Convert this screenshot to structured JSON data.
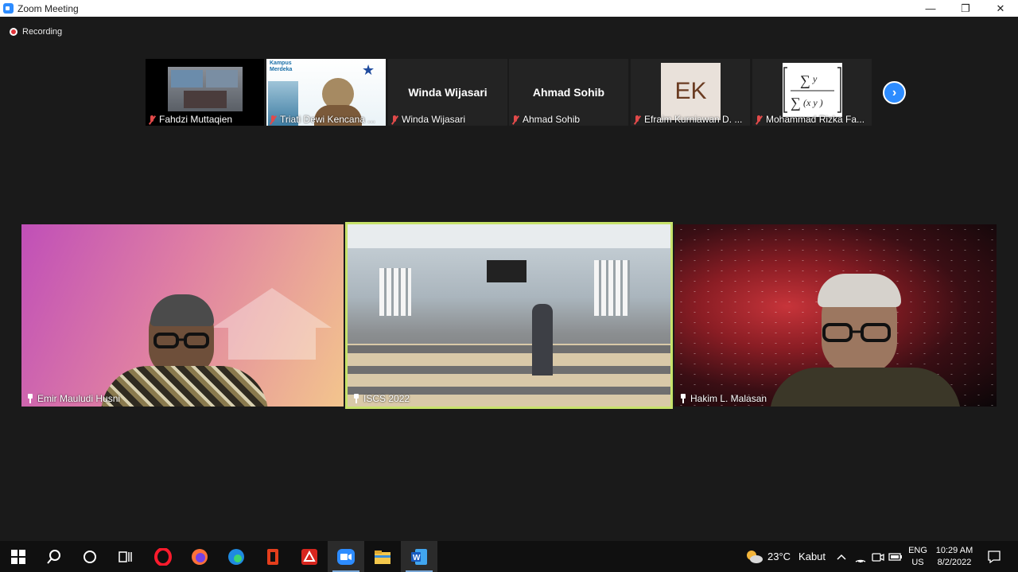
{
  "window": {
    "title": "Zoom Meeting",
    "minimize": "—",
    "maximize": "❐",
    "close": "✕"
  },
  "recording": {
    "label": "Recording"
  },
  "thumbnails": [
    {
      "name": "Fahdzi Muttaqien",
      "display": ""
    },
    {
      "name": "Triati Dewi Kencana ...",
      "display": ""
    },
    {
      "name": "Winda Wijasari",
      "display": "Winda Wijasari"
    },
    {
      "name": "Ahmad Sohib",
      "display": "Ahmad Sohib"
    },
    {
      "name": "Efraim Kurniawan D. ...",
      "display": "EK"
    },
    {
      "name": "Mohammad Rizka Fa...",
      "display": ""
    }
  ],
  "thumb_logo": {
    "line1": "Kampus",
    "line2": "Merdeka"
  },
  "next_button": "›",
  "tiles": [
    {
      "name": "Emir Mauludi Husni"
    },
    {
      "name": "ISCS 2022"
    },
    {
      "name": "Hakim L. Malasan"
    }
  ],
  "accent": {
    "zoom_blue": "#2D8CFF",
    "active_speaker": "#c7e26b",
    "muted_red": "#e24a4a"
  },
  "taskbar": {
    "weather": {
      "temp": "23°C",
      "desc": "Kabut"
    },
    "lang": {
      "line1": "ENG",
      "line2": "US"
    },
    "clock": {
      "time": "10:29 AM",
      "date": "8/2/2022"
    }
  }
}
